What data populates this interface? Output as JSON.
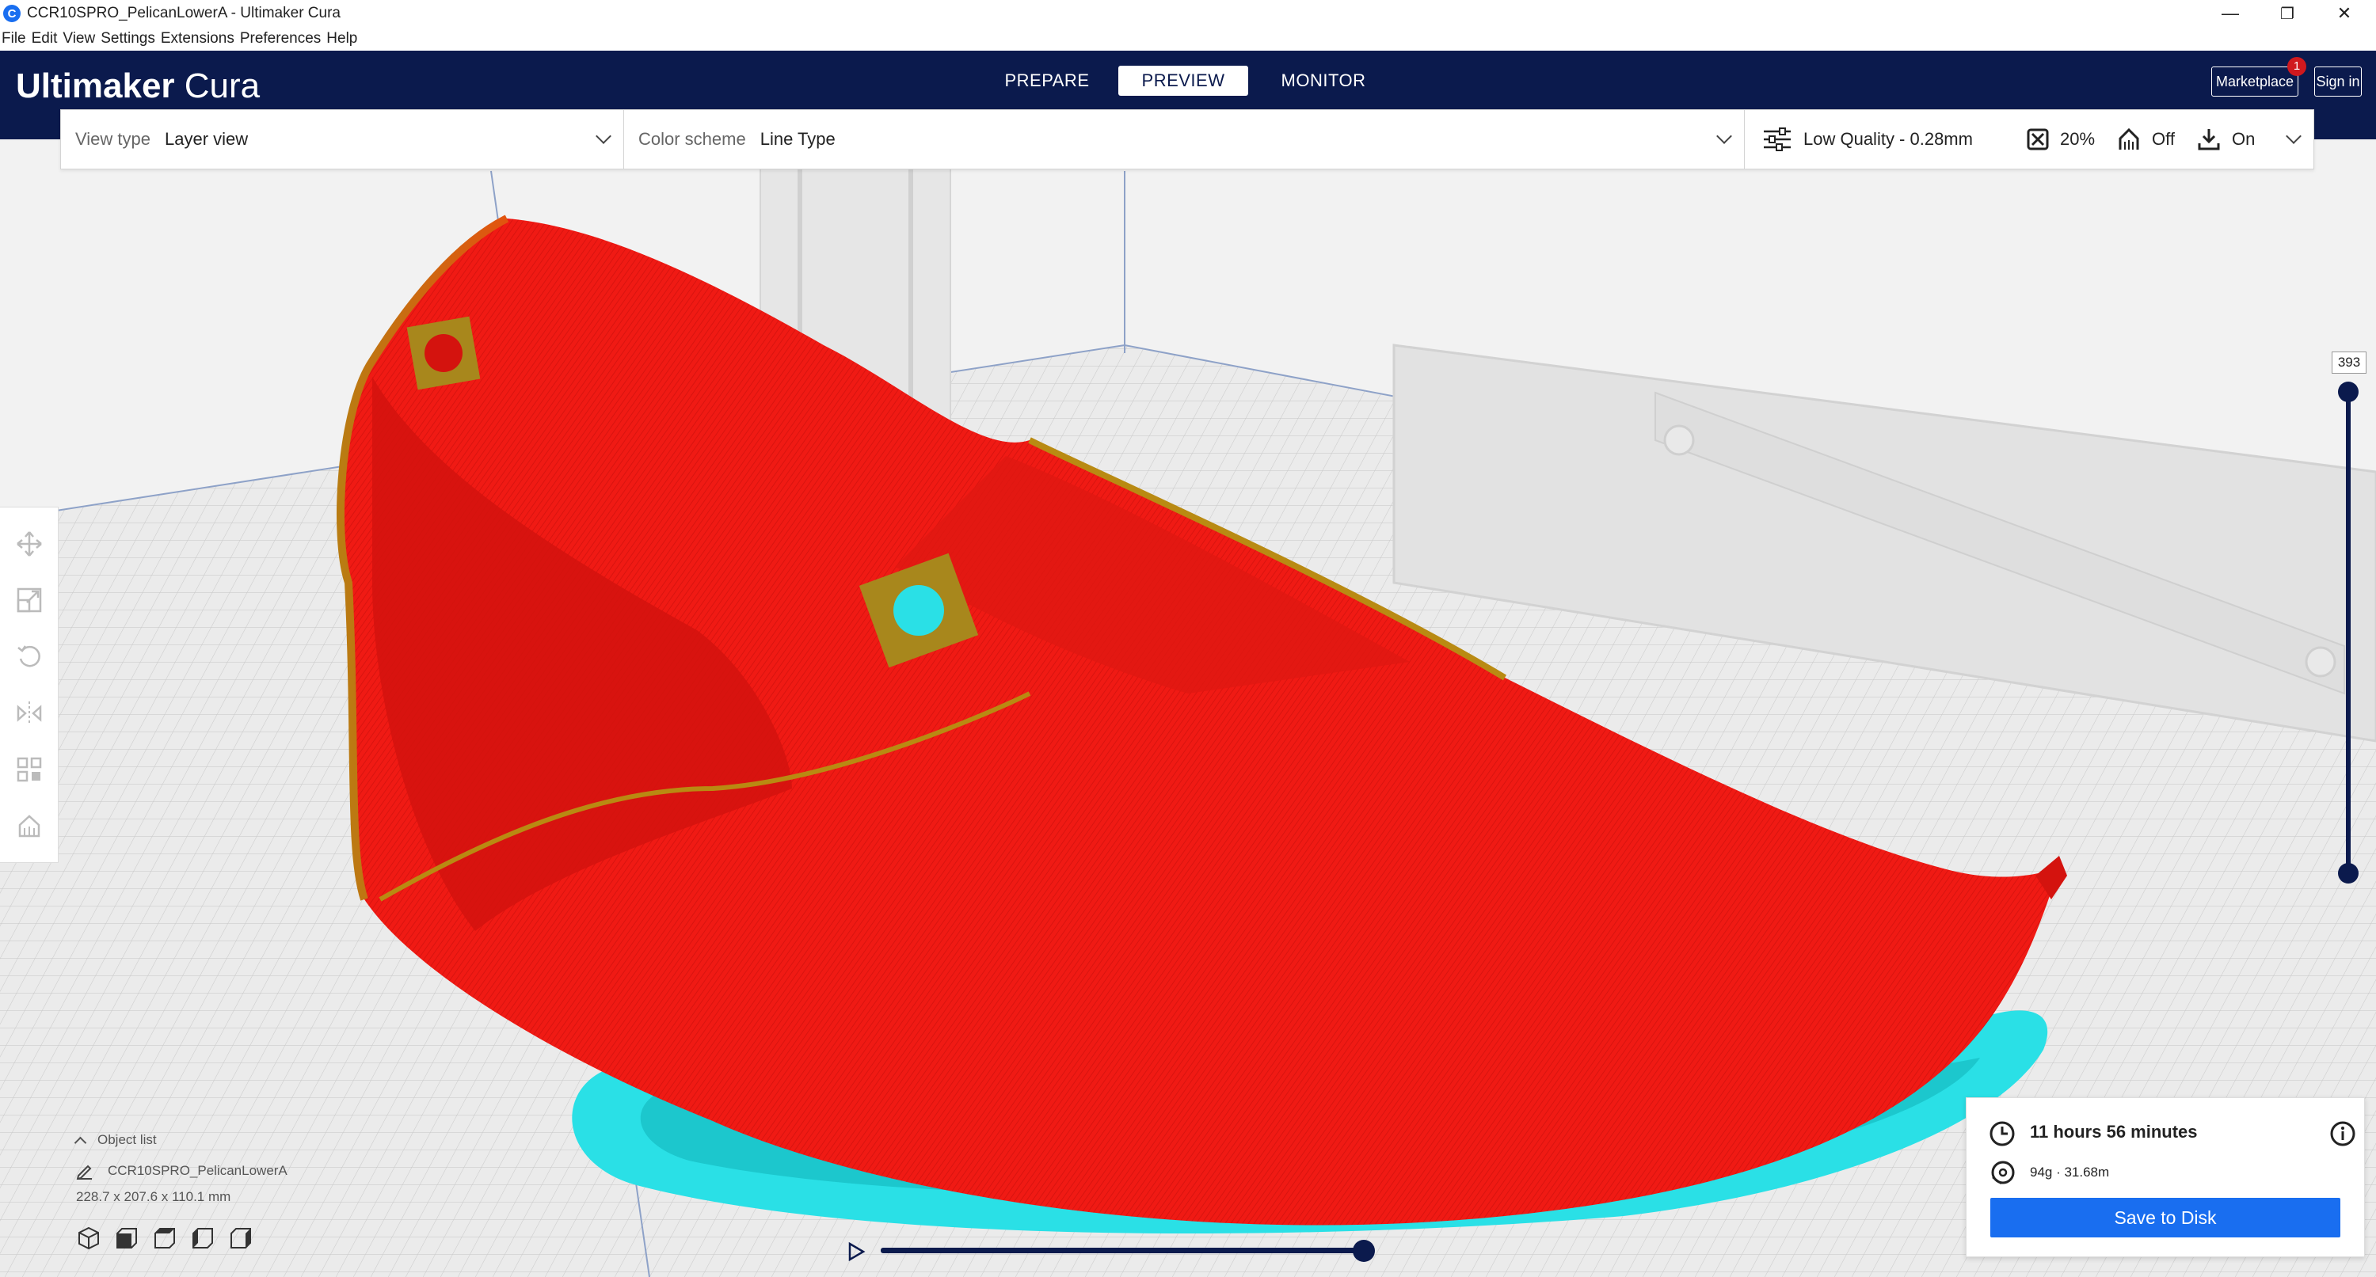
{
  "window": {
    "title": "CCR10SPRO_PelicanLowerA - Ultimaker Cura",
    "logo_letter": "C",
    "minimize": "—",
    "maximize": "❐",
    "close": "✕"
  },
  "menu": [
    "File",
    "Edit",
    "View",
    "Settings",
    "Extensions",
    "Preferences",
    "Help"
  ],
  "header": {
    "brand_bold": "Ultimaker",
    "brand_light": " Cura",
    "stages": {
      "prepare": "PREPARE",
      "preview": "PREVIEW",
      "monitor": "MONITOR"
    },
    "marketplace": "Marketplace",
    "marketplace_badge": "1",
    "sign_in": "Sign in"
  },
  "toolbar": {
    "view_type_label": "View type",
    "view_type_value": "Layer view",
    "color_scheme_label": "Color scheme",
    "color_scheme_value": "Line Type",
    "profile": "Low Quality - 0.28mm",
    "infill": "20%",
    "support": "Off",
    "adhesion": "On"
  },
  "layer_slider": {
    "value": "393"
  },
  "object_list": {
    "label": "Object list",
    "object_name": "CCR10SPRO_PelicanLowerA",
    "dimensions": "228.7 x 207.6 x 110.1 mm"
  },
  "print_info": {
    "time": "11 hours 56 minutes",
    "material": "94g · 31.68m",
    "save_button": "Save to Disk"
  },
  "colors": {
    "header_bg": "#0b1a4d",
    "accent": "#196ef0",
    "model_red": "#f01a14",
    "skirt_cyan": "#2ae0e6",
    "badge": "#d0191e"
  }
}
